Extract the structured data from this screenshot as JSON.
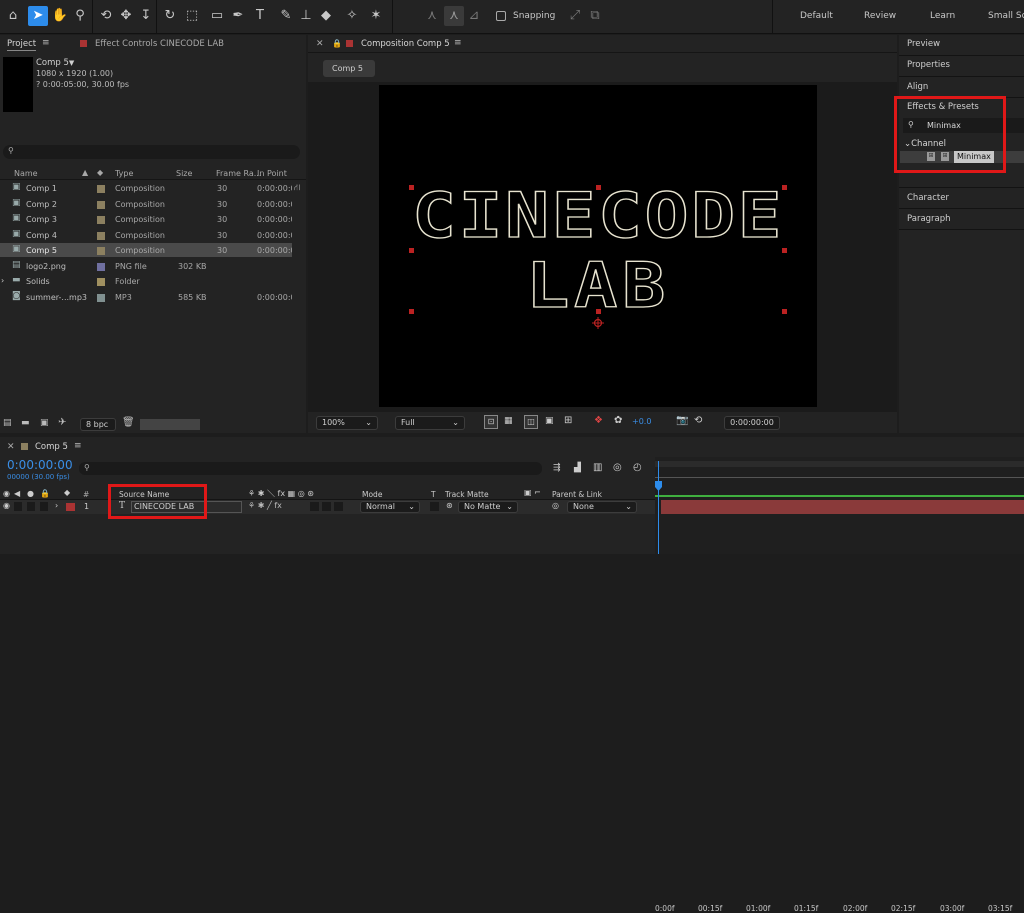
{
  "toolbar": {
    "snapping_label": "Snapping",
    "workspaces": [
      "Default",
      "Review",
      "Learn",
      "Small Sc"
    ]
  },
  "project": {
    "tab_project": "Project",
    "tab_effect_controls": "Effect Controls CINECODE LAB",
    "comp_name": "Comp 5",
    "comp_size": "1080 x 1920 (1.00)",
    "comp_duration": "? 0:00:05:00, 30.00 fps",
    "search_placeholder": "",
    "columns": {
      "name": "Name",
      "type": "Type",
      "size": "Size",
      "frame_rate": "Frame Ra...",
      "in_point": "In Point"
    },
    "items": [
      {
        "name": "Comp 1",
        "type": "Composition",
        "size": "",
        "fps": "30",
        "in": "0:00:00:0",
        "color": "#8c8060",
        "kind": "comp"
      },
      {
        "name": "Comp 2",
        "type": "Composition",
        "size": "",
        "fps": "30",
        "in": "0:00:00:0",
        "color": "#8c8060",
        "kind": "comp"
      },
      {
        "name": "Comp 3",
        "type": "Composition",
        "size": "",
        "fps": "30",
        "in": "0:00:00:0",
        "color": "#8c8060",
        "kind": "comp"
      },
      {
        "name": "Comp 4",
        "type": "Composition",
        "size": "",
        "fps": "30",
        "in": "0:00:00:0",
        "color": "#8c8060",
        "kind": "comp"
      },
      {
        "name": "Comp 5",
        "type": "Composition",
        "size": "",
        "fps": "30",
        "in": "0:00:00:0",
        "color": "#8c8060",
        "kind": "comp",
        "selected": true
      },
      {
        "name": "logo2.png",
        "type": "PNG file",
        "size": "302 KB",
        "fps": "",
        "in": "",
        "color": "#7070a0",
        "kind": "png"
      },
      {
        "name": "Solids",
        "type": "Folder",
        "size": "",
        "fps": "",
        "in": "",
        "color": "#a09060",
        "kind": "folder"
      },
      {
        "name": "summer-...mp3",
        "type": "MP3",
        "size": "585 KB",
        "fps": "",
        "in": "0:00:00:0",
        "color": "#809090",
        "kind": "mp3"
      }
    ],
    "bpc": "8 bpc"
  },
  "composition": {
    "tab_label": "Composition Comp 5",
    "comp_button": "Comp 5",
    "title_line1": "CINECODE",
    "title_line2": "LAB",
    "zoom": "100%",
    "resolution": "Full",
    "exposure": "+0.0",
    "timecode": "0:00:00:00"
  },
  "right_panel": {
    "preview": "Preview",
    "properties": "Properties",
    "align": "Align",
    "effects_presets": "Effects & Presets",
    "search_value": "Minimax",
    "category": "Channel",
    "effect": "Minimax",
    "character": "Character",
    "paragraph": "Paragraph"
  },
  "timeline": {
    "tab": "Comp 5",
    "time": "0:00:00:00",
    "frames": "00000 (30.00 fps)",
    "search_placeholder": "",
    "col_source_name": "Source Name",
    "col_mode": "Mode",
    "col_t": "T",
    "col_track_matte": "Track Matte",
    "col_parent": "Parent & Link",
    "layer": {
      "number": "1",
      "name": "CINECODE LAB",
      "mode": "Normal",
      "track_matte": "No Matte",
      "parent": "None"
    },
    "ruler": [
      "0:00f",
      "00:15f",
      "01:00f",
      "01:15f",
      "02:00f",
      "02:15f",
      "03:00f",
      "03:15f"
    ],
    "layer_bar_color": "#8a3a3a",
    "highlight_color": "#e01818"
  }
}
